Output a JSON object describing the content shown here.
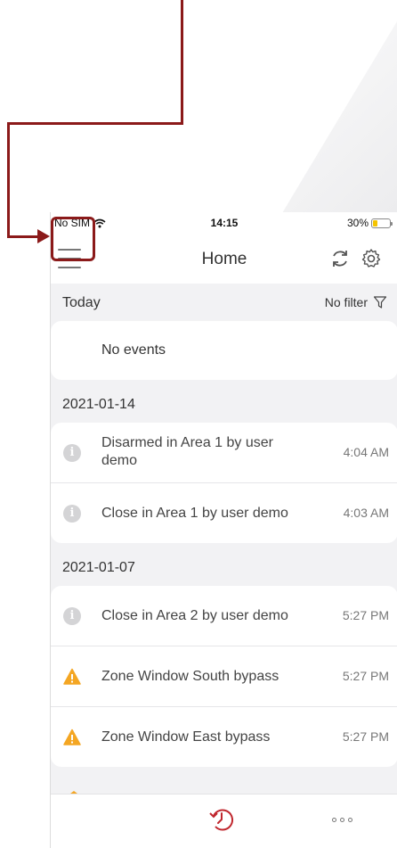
{
  "status_bar": {
    "carrier": "No SIM",
    "time": "14:15",
    "battery": "30%",
    "battery_level": 0.3
  },
  "header": {
    "title": "Home"
  },
  "today": {
    "label": "Today",
    "filter_label": "No filter",
    "empty_text": "No events"
  },
  "groups": [
    {
      "date": "2021-01-14",
      "events": [
        {
          "icon": "info-icon",
          "text": "Disarmed in Area 1 by user demo",
          "time": "4:04 AM"
        },
        {
          "icon": "info-icon",
          "text": "Close in Area 1 by user demo",
          "time": "4:03 AM"
        }
      ]
    },
    {
      "date": "2021-01-07",
      "events": [
        {
          "icon": "info-icon",
          "text": "Close in Area 2 by user demo",
          "time": "5:27 PM"
        },
        {
          "icon": "warning-icon",
          "text": "Zone Window South bypass",
          "time": "5:27 PM"
        },
        {
          "icon": "warning-icon",
          "text": "Zone Window East bypass",
          "time": "5:27 PM"
        }
      ]
    }
  ],
  "colors": {
    "accent": "#c0262d",
    "annotation": "#8b1a1a",
    "warning": "#f4a623",
    "info": "#d4d4d6"
  }
}
